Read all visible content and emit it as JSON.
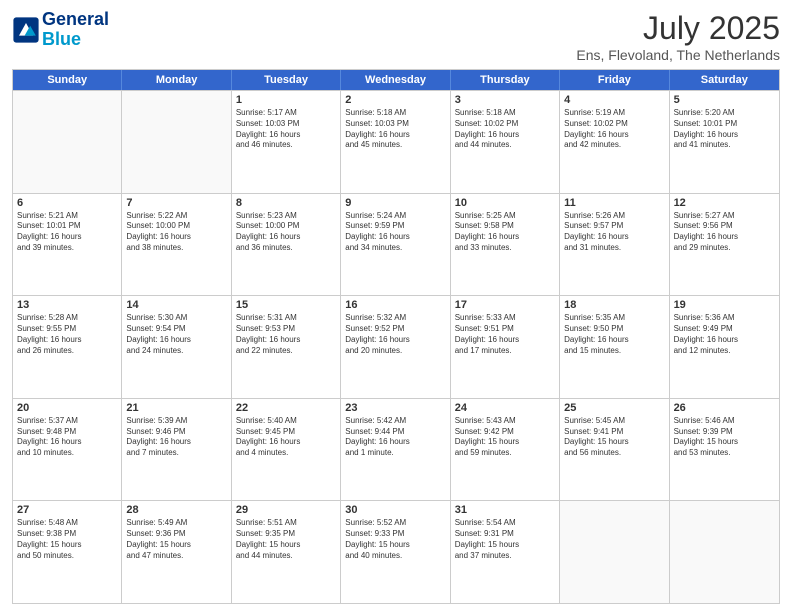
{
  "header": {
    "logo_line1": "General",
    "logo_line2": "Blue",
    "month_year": "July 2025",
    "location": "Ens, Flevoland, The Netherlands"
  },
  "weekdays": [
    "Sunday",
    "Monday",
    "Tuesday",
    "Wednesday",
    "Thursday",
    "Friday",
    "Saturday"
  ],
  "rows": [
    [
      {
        "day": "",
        "text": ""
      },
      {
        "day": "",
        "text": ""
      },
      {
        "day": "1",
        "text": "Sunrise: 5:17 AM\nSunset: 10:03 PM\nDaylight: 16 hours\nand 46 minutes."
      },
      {
        "day": "2",
        "text": "Sunrise: 5:18 AM\nSunset: 10:03 PM\nDaylight: 16 hours\nand 45 minutes."
      },
      {
        "day": "3",
        "text": "Sunrise: 5:18 AM\nSunset: 10:02 PM\nDaylight: 16 hours\nand 44 minutes."
      },
      {
        "day": "4",
        "text": "Sunrise: 5:19 AM\nSunset: 10:02 PM\nDaylight: 16 hours\nand 42 minutes."
      },
      {
        "day": "5",
        "text": "Sunrise: 5:20 AM\nSunset: 10:01 PM\nDaylight: 16 hours\nand 41 minutes."
      }
    ],
    [
      {
        "day": "6",
        "text": "Sunrise: 5:21 AM\nSunset: 10:01 PM\nDaylight: 16 hours\nand 39 minutes."
      },
      {
        "day": "7",
        "text": "Sunrise: 5:22 AM\nSunset: 10:00 PM\nDaylight: 16 hours\nand 38 minutes."
      },
      {
        "day": "8",
        "text": "Sunrise: 5:23 AM\nSunset: 10:00 PM\nDaylight: 16 hours\nand 36 minutes."
      },
      {
        "day": "9",
        "text": "Sunrise: 5:24 AM\nSunset: 9:59 PM\nDaylight: 16 hours\nand 34 minutes."
      },
      {
        "day": "10",
        "text": "Sunrise: 5:25 AM\nSunset: 9:58 PM\nDaylight: 16 hours\nand 33 minutes."
      },
      {
        "day": "11",
        "text": "Sunrise: 5:26 AM\nSunset: 9:57 PM\nDaylight: 16 hours\nand 31 minutes."
      },
      {
        "day": "12",
        "text": "Sunrise: 5:27 AM\nSunset: 9:56 PM\nDaylight: 16 hours\nand 29 minutes."
      }
    ],
    [
      {
        "day": "13",
        "text": "Sunrise: 5:28 AM\nSunset: 9:55 PM\nDaylight: 16 hours\nand 26 minutes."
      },
      {
        "day": "14",
        "text": "Sunrise: 5:30 AM\nSunset: 9:54 PM\nDaylight: 16 hours\nand 24 minutes."
      },
      {
        "day": "15",
        "text": "Sunrise: 5:31 AM\nSunset: 9:53 PM\nDaylight: 16 hours\nand 22 minutes."
      },
      {
        "day": "16",
        "text": "Sunrise: 5:32 AM\nSunset: 9:52 PM\nDaylight: 16 hours\nand 20 minutes."
      },
      {
        "day": "17",
        "text": "Sunrise: 5:33 AM\nSunset: 9:51 PM\nDaylight: 16 hours\nand 17 minutes."
      },
      {
        "day": "18",
        "text": "Sunrise: 5:35 AM\nSunset: 9:50 PM\nDaylight: 16 hours\nand 15 minutes."
      },
      {
        "day": "19",
        "text": "Sunrise: 5:36 AM\nSunset: 9:49 PM\nDaylight: 16 hours\nand 12 minutes."
      }
    ],
    [
      {
        "day": "20",
        "text": "Sunrise: 5:37 AM\nSunset: 9:48 PM\nDaylight: 16 hours\nand 10 minutes."
      },
      {
        "day": "21",
        "text": "Sunrise: 5:39 AM\nSunset: 9:46 PM\nDaylight: 16 hours\nand 7 minutes."
      },
      {
        "day": "22",
        "text": "Sunrise: 5:40 AM\nSunset: 9:45 PM\nDaylight: 16 hours\nand 4 minutes."
      },
      {
        "day": "23",
        "text": "Sunrise: 5:42 AM\nSunset: 9:44 PM\nDaylight: 16 hours\nand 1 minute."
      },
      {
        "day": "24",
        "text": "Sunrise: 5:43 AM\nSunset: 9:42 PM\nDaylight: 15 hours\nand 59 minutes."
      },
      {
        "day": "25",
        "text": "Sunrise: 5:45 AM\nSunset: 9:41 PM\nDaylight: 15 hours\nand 56 minutes."
      },
      {
        "day": "26",
        "text": "Sunrise: 5:46 AM\nSunset: 9:39 PM\nDaylight: 15 hours\nand 53 minutes."
      }
    ],
    [
      {
        "day": "27",
        "text": "Sunrise: 5:48 AM\nSunset: 9:38 PM\nDaylight: 15 hours\nand 50 minutes."
      },
      {
        "day": "28",
        "text": "Sunrise: 5:49 AM\nSunset: 9:36 PM\nDaylight: 15 hours\nand 47 minutes."
      },
      {
        "day": "29",
        "text": "Sunrise: 5:51 AM\nSunset: 9:35 PM\nDaylight: 15 hours\nand 44 minutes."
      },
      {
        "day": "30",
        "text": "Sunrise: 5:52 AM\nSunset: 9:33 PM\nDaylight: 15 hours\nand 40 minutes."
      },
      {
        "day": "31",
        "text": "Sunrise: 5:54 AM\nSunset: 9:31 PM\nDaylight: 15 hours\nand 37 minutes."
      },
      {
        "day": "",
        "text": ""
      },
      {
        "day": "",
        "text": ""
      }
    ]
  ]
}
